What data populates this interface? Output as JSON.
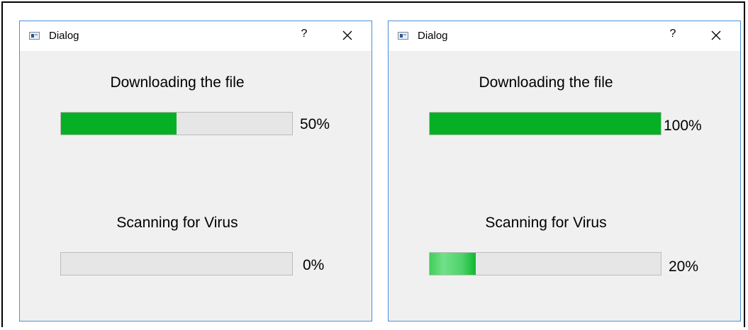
{
  "dialogs": [
    {
      "title": "Dialog",
      "help_label": "?",
      "download": {
        "label": "Downloading the file",
        "percent_text": "50%",
        "progress": 0.5
      },
      "scan": {
        "label": "Scanning for Virus",
        "percent_text": "0%",
        "progress": 0.0
      }
    },
    {
      "title": "Dialog",
      "help_label": "?",
      "download": {
        "label": "Downloading the file",
        "percent_text": "100%",
        "progress": 1.0
      },
      "scan": {
        "label": "Scanning for Virus",
        "percent_text": "20%",
        "progress": 0.2
      }
    }
  ],
  "colors": {
    "progress_fill": "#06b025",
    "progress_track": "#e6e6e6",
    "dialog_border": "#4a90d9",
    "dialog_background": "#f0f0f0"
  },
  "icons": {
    "app": "window-app-icon",
    "help": "help-icon",
    "close": "close-icon"
  }
}
